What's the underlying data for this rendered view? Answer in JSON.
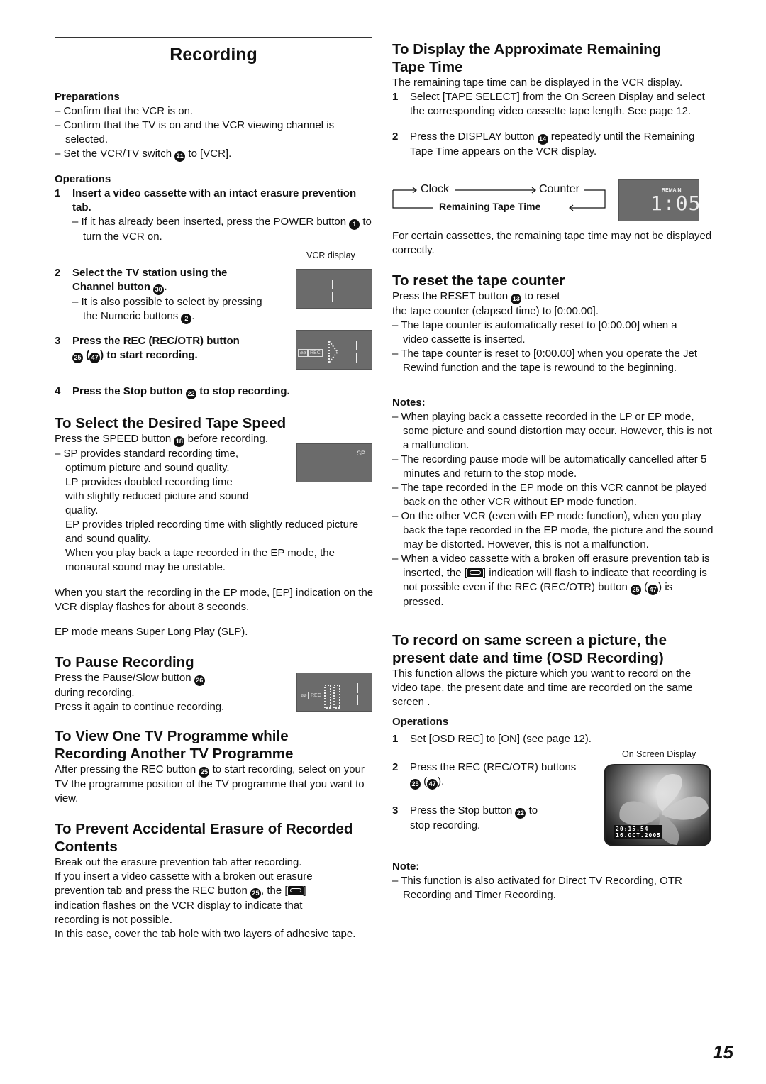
{
  "page": {
    "title": "Recording",
    "page_number": "15"
  },
  "left": {
    "preparations": {
      "heading": "Preparations",
      "items": [
        "Confirm that the VCR is on.",
        "Confirm that the TV is on and the VCR viewing channel is selected."
      ],
      "item3_pre": "Set the VCR/TV switch",
      "item3_ref": "21",
      "item3_post": "to [VCR]."
    },
    "operations": {
      "heading": "Operations",
      "step1": {
        "num": "1",
        "text": "Insert a video cassette with an intact erasure prevention tab.",
        "sub_pre": "If it has already been inserted, press the POWER button",
        "sub_ref": "1",
        "sub_post": "to turn the VCR on."
      },
      "vcr_display_label": "VCR display",
      "step2": {
        "num": "2",
        "text_pre": "Select the TV station using the Channel button",
        "ref": "30",
        "text_post": ".",
        "sub_pre": "It is also possible to select by pressing the Numeric buttons",
        "sub_ref": "2",
        "sub_post": "."
      },
      "step3": {
        "num": "3",
        "text_pre": "Press the REC (REC/OTR) button",
        "ref1": "25",
        "ref2": "47",
        "text_post": "to start recording."
      },
      "step4": {
        "num": "4",
        "text_pre": "Press the Stop button",
        "ref": "22",
        "text_post": "to stop recording."
      }
    },
    "tape_speed": {
      "heading": "To Select the Desired Tape Speed",
      "intro_pre": "Press the SPEED button",
      "intro_ref": "18",
      "intro_post": "before recording.",
      "sp": "SP provides standard recording time, optimum picture and sound quality.",
      "lp": "LP provides doubled recording time with slightly reduced picture and sound quality.",
      "ep": "EP provides tripled recording time with slightly reduced picture and sound quality.",
      "ep_note": "When you play back a tape recorded in the EP mode, the monaural sound may be unstable.",
      "display_text": "SP",
      "para1": "When you start the recording in the EP mode, [EP] indication on the VCR display flashes for about 8 seconds.",
      "para2": "EP mode means Super Long Play (SLP)."
    },
    "pause": {
      "heading": "To Pause Recording",
      "line1_pre": "Press the Pause/Slow button",
      "line1_ref": "26",
      "line2": "during recording.",
      "line3": "Press it again to continue recording."
    },
    "view_other": {
      "heading": "To View One TV Programme while Recording Another TV Programme",
      "text_pre": "After pressing the REC button",
      "ref": "25",
      "text_post": "to start recording, select on your TV the programme position of the TV programme that you want to view."
    },
    "prevent": {
      "heading": "To Prevent Accidental Erasure of Recorded Contents",
      "p1": "Break out the erasure prevention tab after recording.",
      "p2_pre": "If you insert a video cassette with a broken out erasure prevention tab and press the REC button",
      "p2_ref": "25",
      "p2_mid": ", the [",
      "p2_post": "] indication flashes on the VCR display to indicate that recording is not possible.",
      "p3": "In this case, cover the tab hole with two layers of adhesive tape."
    },
    "lcd_badges": {
      "tape": "⌀⌀",
      "rec": "REC"
    }
  },
  "right": {
    "remaining": {
      "heading": "To Display the Approximate Remaining Tape Time",
      "intro": "The remaining tape time can be displayed in the VCR display.",
      "step1": {
        "num": "1",
        "text": "Select [TAPE SELECT] from the On Screen Display and select the corresponding video cassette tape length. See page 12."
      },
      "step2": {
        "num": "2",
        "text_pre": "Press the DISPLAY button",
        "ref": "14",
        "text_post": "repeatedly until the Remaining Tape Time appears on the VCR display."
      },
      "cycle": {
        "clock": "Clock",
        "counter": "Counter",
        "remaining": "Remaining Tape Time"
      },
      "display_label": "REMAIN",
      "display_value": "1:05",
      "note": "For certain cassettes, the remaining tape time may not be displayed correctly."
    },
    "reset": {
      "heading": "To reset the tape counter",
      "l1_pre": "Press the RESET button",
      "l1_ref": "13",
      "l1_post": "to reset",
      "l2": "the tape counter (elapsed time) to [0:00.00].",
      "items": [
        "The tape counter is automatically reset to [0:00.00] when a video cassette is inserted.",
        "The tape counter is reset to [0:00.00] when you operate the Jet Rewind function and the tape is rewound to the beginning."
      ]
    },
    "notes": {
      "heading": "Notes:",
      "items": [
        "When playing back a cassette recorded in the LP or EP mode, some picture and sound distortion may occur. However, this is not a malfunction.",
        "The recording pause mode will be automatically cancelled after 5 minutes and return to the stop mode.",
        "The tape recorded in the EP mode on this VCR cannot be played back on the other VCR without EP mode function.",
        "On the other VCR (even with EP mode function), when you play back the tape recorded in the EP mode, the picture and the sound may be distorted. However, this is not a malfunction."
      ],
      "last_pre": "When a video cassette with a broken off erasure prevention tab is inserted, the [",
      "last_mid": "] indication will flash to indicate that recording is not possible even if the REC (REC/OTR) button",
      "last_ref1": "25",
      "last_ref2": "47",
      "last_post": "is pressed."
    },
    "osd": {
      "heading": "To record on same screen a picture, the present date and time (OSD Recording)",
      "intro": "This function allows the picture which you want to record on the video tape, the present date and time are recorded on the same screen .",
      "ops_heading": "Operations",
      "step1": {
        "num": "1",
        "text": "Set [OSD REC] to [ON] (see page 12)."
      },
      "display_label": "On Screen Display",
      "step2": {
        "num": "2",
        "text_pre": "Press the REC (REC/OTR) buttons",
        "ref1": "25",
        "ref2": "47",
        "text_post": "."
      },
      "step3": {
        "num": "3",
        "text_pre": "Press the Stop button",
        "ref": "22",
        "text_post": "to stop recording."
      },
      "osd_time": "20:15.54",
      "osd_date": "16.OCT.2005",
      "note_heading": "Note:",
      "note": "This function is also activated for Direct TV Recording, OTR Recording and Timer Recording."
    }
  }
}
